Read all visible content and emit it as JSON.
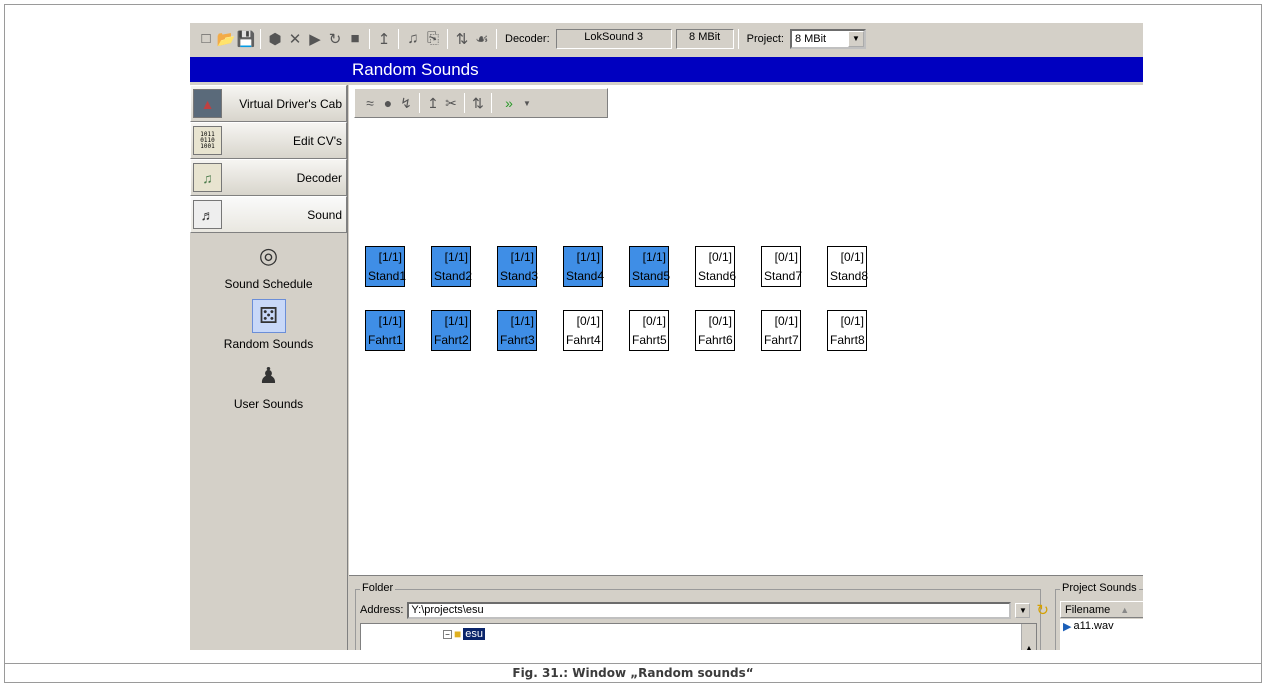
{
  "toolbar": {
    "icons": [
      "new-icon",
      "open-icon",
      "save-icon",
      "record-icon",
      "delete-icon",
      "play-icon",
      "loop-icon",
      "stop-icon",
      "probe-icon",
      "import-icon",
      "export-icon",
      "split-icon",
      "tree-icon"
    ],
    "decoder_label": "Decoder:",
    "decoder_value": "LokSound 3",
    "decoder_size": "8 MBit",
    "project_label": "Project:",
    "project_value": "8 MBit"
  },
  "title": "Random Sounds",
  "nav": {
    "items": [
      {
        "label": "Virtual Driver's Cab",
        "icon": "cab-icon"
      },
      {
        "label": "Edit CV's",
        "icon": "binary-icon"
      },
      {
        "label": "Decoder",
        "icon": "decoder-icon"
      },
      {
        "label": "Sound",
        "icon": "music-icon"
      }
    ],
    "sub_items": [
      {
        "label": "Sound Schedule",
        "icon": "schedule-icon"
      },
      {
        "label": "Random Sounds",
        "icon": "dice-icon"
      },
      {
        "label": "User Sounds",
        "icon": "user-sound-icon"
      }
    ]
  },
  "grid": {
    "stand": [
      {
        "name": "Stand1",
        "count": "[1/1]",
        "active": true
      },
      {
        "name": "Stand2",
        "count": "[1/1]",
        "active": true
      },
      {
        "name": "Stand3",
        "count": "[1/1]",
        "active": true
      },
      {
        "name": "Stand4",
        "count": "[1/1]",
        "active": true
      },
      {
        "name": "Stand5",
        "count": "[1/1]",
        "active": true
      },
      {
        "name": "Stand6",
        "count": "[0/1]",
        "active": false
      },
      {
        "name": "Stand7",
        "count": "[0/1]",
        "active": false
      },
      {
        "name": "Stand8",
        "count": "[0/1]",
        "active": false
      }
    ],
    "fahrt": [
      {
        "name": "Fahrt1",
        "count": "[1/1]",
        "active": true
      },
      {
        "name": "Fahrt2",
        "count": "[1/1]",
        "active": true
      },
      {
        "name": "Fahrt3",
        "count": "[1/1]",
        "active": true
      },
      {
        "name": "Fahrt4",
        "count": "[0/1]",
        "active": false
      },
      {
        "name": "Fahrt5",
        "count": "[0/1]",
        "active": false
      },
      {
        "name": "Fahrt6",
        "count": "[0/1]",
        "active": false
      },
      {
        "name": "Fahrt7",
        "count": "[0/1]",
        "active": false
      },
      {
        "name": "Fahrt8",
        "count": "[0/1]",
        "active": false
      }
    ]
  },
  "folder": {
    "legend": "Folder",
    "address_label": "Address:",
    "address_value": "Y:\\projects\\esu",
    "tree_item": "esu"
  },
  "project_sounds": {
    "legend": "Project Sounds",
    "column": "Filename",
    "files": [
      "a11.wav"
    ]
  },
  "caption": "Fig. 31.: Window „Random sounds“",
  "colors": {
    "title_bar": "#0000c0",
    "active_sound": "#3f8ee6"
  }
}
